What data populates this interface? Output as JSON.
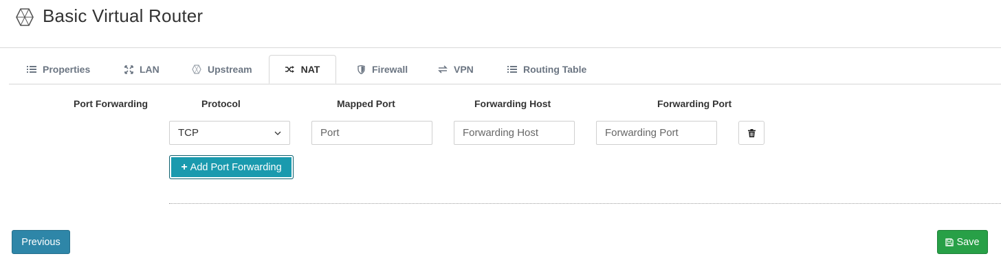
{
  "header": {
    "title": "Basic Virtual Router"
  },
  "tabs": [
    {
      "label": "Properties"
    },
    {
      "label": "LAN"
    },
    {
      "label": "Upstream"
    },
    {
      "label": "NAT"
    },
    {
      "label": "Firewall"
    },
    {
      "label": "VPN"
    },
    {
      "label": "Routing Table"
    }
  ],
  "active_tab": "NAT",
  "port_forwarding": {
    "section_label": "Port Forwarding",
    "columns": [
      "Protocol",
      "Mapped Port",
      "Forwarding Host",
      "Forwarding Port"
    ],
    "row": {
      "protocol": "TCP",
      "mapped_port_placeholder": "Port",
      "forwarding_host_placeholder": "Forwarding Host",
      "forwarding_port_placeholder": "Forwarding Port"
    },
    "add_label": "Add Port Forwarding"
  },
  "footer": {
    "previous_label": "Previous",
    "save_label": "Save"
  },
  "colors": {
    "accent": "#1a9aae",
    "previous": "#2e86a8",
    "save": "#28a047"
  }
}
